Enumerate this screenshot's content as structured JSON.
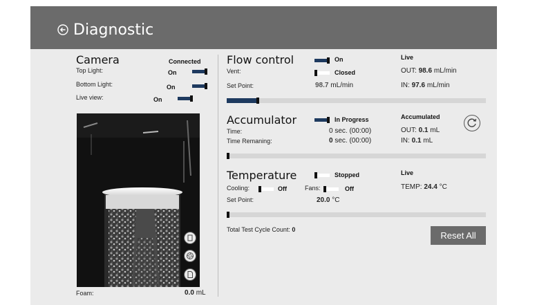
{
  "header": {
    "title": "Diagnostic"
  },
  "camera": {
    "title": "Camera",
    "status": "Connected",
    "top_light": {
      "label": "Top Light:",
      "value": "On"
    },
    "bottom_light": {
      "label": "Bottom Light:",
      "value": "On"
    },
    "live_view": {
      "label": "Live view:",
      "value": "On"
    },
    "foam": {
      "label": "Foam:",
      "value": "0.0",
      "unit": "mL"
    }
  },
  "flow": {
    "title": "Flow control",
    "toggle": "On",
    "vent_label": "Vent:",
    "vent_value": "Closed",
    "setpoint_label": "Set Point:",
    "setpoint_value": "98.7",
    "setpoint_unit": "mL/min",
    "slider_fraction": 0.12,
    "live_title": "Live",
    "out_label": "OUT:",
    "out_value": "98.6",
    "out_unit": "mL/min",
    "in_label": "IN:",
    "in_value": "97.6",
    "in_unit": "mL/min"
  },
  "accumulator": {
    "title": "Accumulator",
    "toggle": "In Progress",
    "time_label": "Time:",
    "time_value": "0",
    "time_detail": "sec. (00:00)",
    "remaining_label": "Time Remaning:",
    "remaining_value": "0",
    "remaining_detail": "sec. (00:00)",
    "slider_fraction": 0.0,
    "acc_title": "Accumulated",
    "out_label": "OUT:",
    "out_value": "0.1",
    "out_unit": "mL",
    "in_label": "IN:",
    "in_value": "0.1",
    "in_unit": "mL"
  },
  "temperature": {
    "title": "Temperature",
    "toggle": "Stopped",
    "cooling_label": "Cooling:",
    "cooling_value": "Off",
    "fans_label": "Fans:",
    "fans_value": "Off",
    "setpoint_label": "Set Point:",
    "setpoint_value": "20.0",
    "setpoint_unit": "°C",
    "slider_fraction": 0.0,
    "live_title": "Live",
    "temp_label": "TEMP:",
    "temp_value": "24.4",
    "temp_unit": "°C"
  },
  "footer": {
    "cycle_label": "Total Test Cycle Count:",
    "cycle_value": "0",
    "reset_label": "Reset All"
  },
  "icons": [
    "back-arrow-icon",
    "refresh-icon",
    "zoom-icon",
    "shutter-icon",
    "file-icon"
  ]
}
